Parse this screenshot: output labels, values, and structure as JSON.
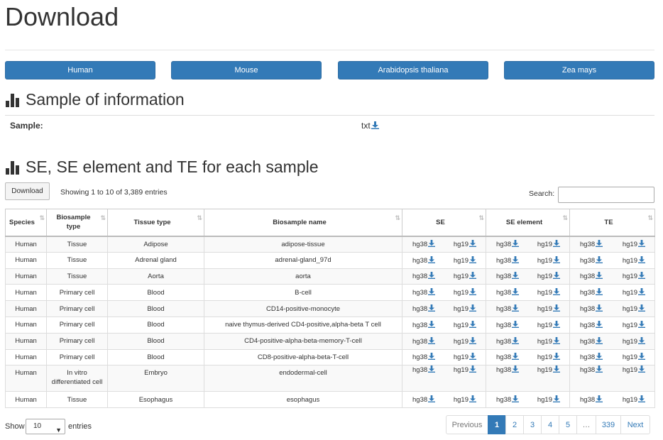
{
  "page": {
    "title": "Download"
  },
  "species_buttons": [
    "Human",
    "Mouse",
    "Arabidopsis thaliana",
    "Zea mays"
  ],
  "sample_section": {
    "title": "Sample of information",
    "label": "Sample:",
    "link": "txt"
  },
  "table_section": {
    "title": "SE, SE element and TE for each sample",
    "download_button": "Download",
    "info": "Showing 1 to 10 of 3,389 entries",
    "search_label": "Search:",
    "search_value": "",
    "columns": [
      "Species",
      "Biosample type",
      "Tissue type",
      "Biosample name",
      "SE",
      "SE element",
      "TE"
    ],
    "link_labels": [
      "hg38",
      "hg19"
    ],
    "rows": [
      [
        "Human",
        "Tissue",
        "Adipose",
        "adipose-tissue"
      ],
      [
        "Human",
        "Tissue",
        "Adrenal gland",
        "adrenal-gland_97d"
      ],
      [
        "Human",
        "Tissue",
        "Aorta",
        "aorta"
      ],
      [
        "Human",
        "Primary cell",
        "Blood",
        "B-cell"
      ],
      [
        "Human",
        "Primary cell",
        "Blood",
        "CD14-positive-monocyte"
      ],
      [
        "Human",
        "Primary cell",
        "Blood",
        "naive thymus-derived CD4-positive,alpha-beta T cell"
      ],
      [
        "Human",
        "Primary cell",
        "Blood",
        "CD4-positive-alpha-beta-memory-T-cell"
      ],
      [
        "Human",
        "Primary cell",
        "Blood",
        "CD8-positive-alpha-beta-T-cell"
      ],
      [
        "Human",
        "In vitro differentiated cell",
        "Embryo",
        "endodermal-cell"
      ],
      [
        "Human",
        "Tissue",
        "Esophagus",
        "esophagus"
      ]
    ]
  },
  "footer": {
    "show_label": "Show",
    "page_size": "10",
    "entries_label": "entries",
    "pagination": {
      "previous": "Previous",
      "pages": [
        "1",
        "2",
        "3",
        "4",
        "5"
      ],
      "ellipsis": "…",
      "last": "339",
      "next": "Next",
      "active_page": "1"
    }
  },
  "colors": {
    "primary": "#337ab7",
    "link": "#337ab7",
    "text": "#333333"
  }
}
